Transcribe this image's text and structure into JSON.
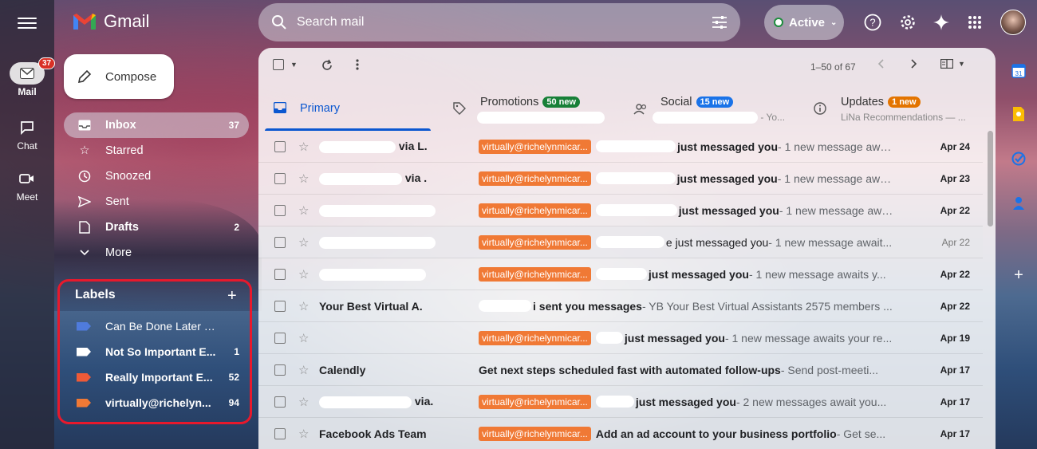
{
  "app": {
    "name": "Gmail"
  },
  "rail": [
    {
      "label": "Mail",
      "badge": "37",
      "icon": "mail-icon",
      "active": true
    },
    {
      "label": "Chat",
      "icon": "chat-icon"
    },
    {
      "label": "Meet",
      "icon": "meet-icon"
    }
  ],
  "search": {
    "placeholder": "Search mail"
  },
  "status": {
    "label": "Active"
  },
  "compose": {
    "label": "Compose"
  },
  "nav": [
    {
      "label": "Inbox",
      "count": "37",
      "icon": "inbox-icon"
    },
    {
      "label": "Starred",
      "count": "",
      "icon": "star-icon"
    },
    {
      "label": "Snoozed",
      "count": "",
      "icon": "clock-icon"
    },
    {
      "label": "Sent",
      "count": "",
      "icon": "send-icon"
    },
    {
      "label": "Drafts",
      "count": "2",
      "icon": "draft-icon"
    },
    {
      "label": "More",
      "count": "",
      "icon": "chevron-down-icon"
    }
  ],
  "labels": {
    "title": "Labels",
    "items": [
      {
        "name": "Can Be Done Later Email",
        "count": "",
        "color": "#4f7bdc"
      },
      {
        "name": "Not So Important E...",
        "count": "1",
        "color": "#ffffff"
      },
      {
        "name": "Really Important E...",
        "count": "52",
        "color": "#ee5a37"
      },
      {
        "name": "virtually@richelyn...",
        "count": "94",
        "color": "#f07935"
      }
    ]
  },
  "toolbar": {
    "range": "1–50 of 67"
  },
  "tabs": {
    "primary": {
      "label": "Primary"
    },
    "promotions": {
      "label": "Promotions",
      "badge": "50 new",
      "badge_color": "#188038"
    },
    "social": {
      "label": "Social",
      "badge": "15 new",
      "badge_color": "#1a73e8",
      "sub": "- Yo..."
    },
    "updates": {
      "label": "Updates",
      "badge": "1 new",
      "badge_color": "#e37400",
      "sub": "LiNa Recommendations — ..."
    }
  },
  "emails": [
    {
      "sender": "via L.",
      "chip": "virtually@richelynmicar...",
      "subject": "just messaged you",
      "snippet": " - 1 new message awaits you...",
      "date": "Apr 24",
      "read": false
    },
    {
      "sender": "via .",
      "chip": "virtually@richelynmicar...",
      "subject": "just messaged you",
      "snippet": " - 1 new message awaits yo...",
      "date": "Apr 23",
      "read": false
    },
    {
      "sender": "",
      "chip": "virtually@richelynmicar...",
      "subject": "just messaged you",
      "snippet": " - 1 new message awaits you...",
      "date": "Apr 22",
      "read": false
    },
    {
      "sender": "",
      "chip": "virtually@richelynmicar...",
      "subject": "e just messaged you",
      "snippet": " - 1 new message await...",
      "date": "Apr 22",
      "read": true
    },
    {
      "sender": "",
      "chip": "virtually@richelynmicar...",
      "subject": "just messaged you",
      "snippet": " - 1 new message awaits y...",
      "date": "Apr 22",
      "read": false
    },
    {
      "sender": "Your Best Virtual A.",
      "chip": "",
      "subject": "i sent you messages",
      "snippet": " - YB Your Best Virtual Assistants 2575 members ...",
      "date": "Apr 22",
      "read": false
    },
    {
      "sender": "",
      "chip": "virtually@richelynmicar...",
      "subject": "just messaged you",
      "snippet": " - 1 new message awaits your re...",
      "date": "Apr 19",
      "read": false
    },
    {
      "sender": "Calendly",
      "chip": "",
      "subject": "Get next steps scheduled fast with automated follow-ups",
      "snippet": " - Send post-meeti...",
      "date": "Apr 17",
      "read": false
    },
    {
      "sender": "via.",
      "chip": "virtually@richelynmicar...",
      "subject": "just messaged you",
      "snippet": " - 2 new messages await you...",
      "date": "Apr 17",
      "read": false
    },
    {
      "sender": "Facebook Ads Team",
      "chip": "virtually@richelynmicar...",
      "subject": "Add an ad account to your business portfolio",
      "snippet": " - Get se...",
      "date": "Apr 17",
      "read": false
    }
  ]
}
